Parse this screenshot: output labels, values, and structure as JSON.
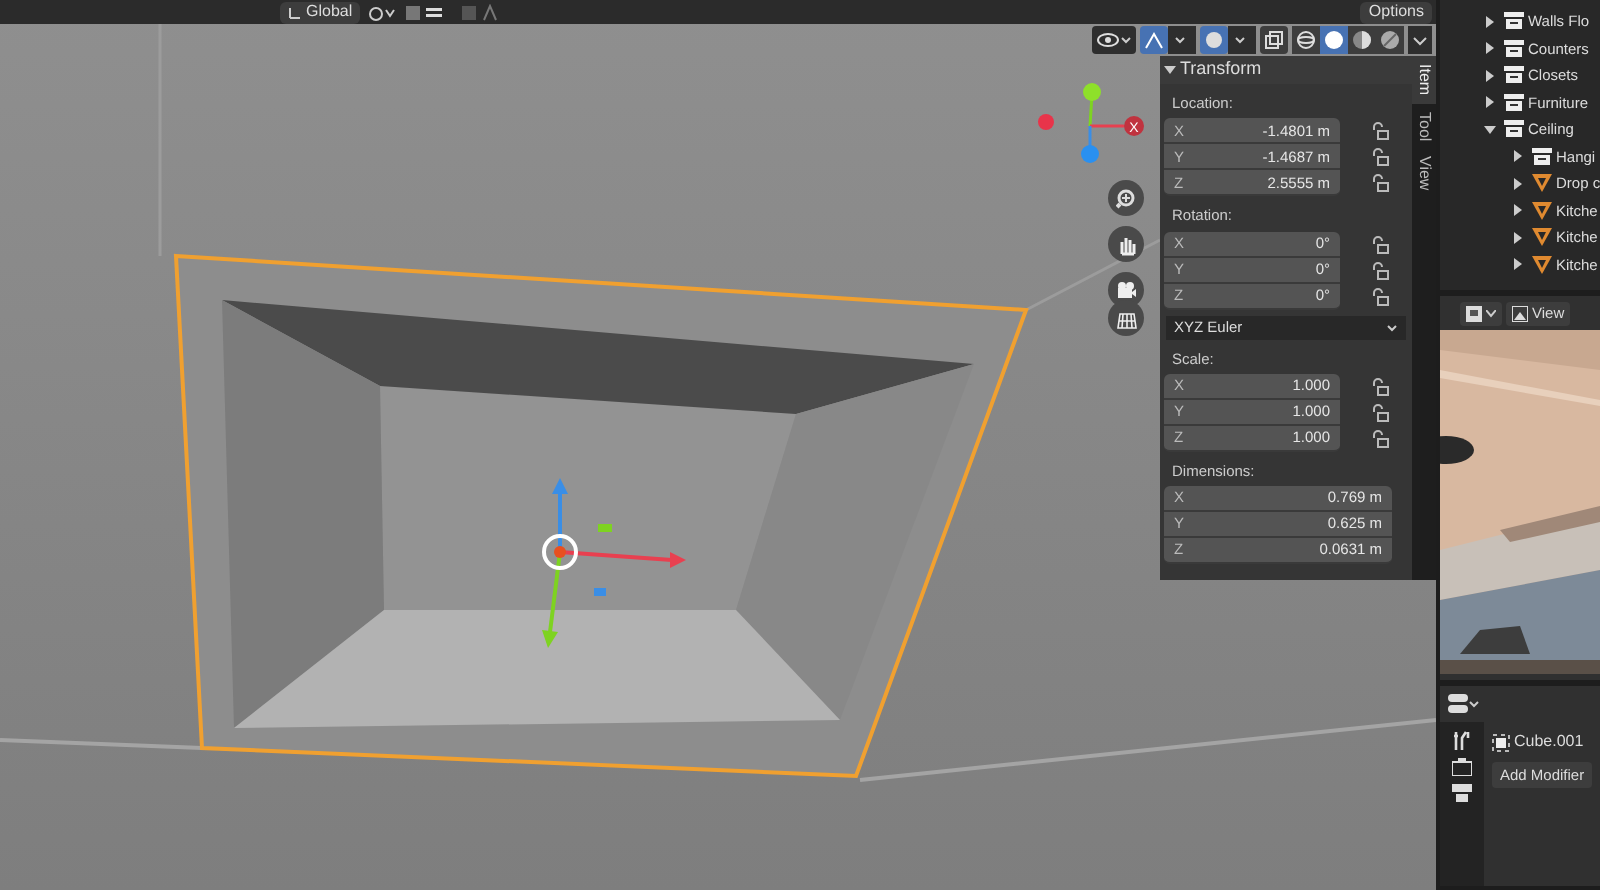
{
  "top_bar": {
    "orientation": "Global",
    "options": "Options"
  },
  "viewport_header": {
    "shading": [
      {
        "kind": "wireframe",
        "selected": false
      },
      {
        "kind": "solid",
        "selected": true
      },
      {
        "kind": "material",
        "selected": false
      },
      {
        "kind": "rendered",
        "selected": false
      }
    ]
  },
  "gizmo": {
    "x_axis": "X"
  },
  "sidebar": {
    "tabs": [
      {
        "label": "Item",
        "selected": true
      },
      {
        "label": "Tool",
        "selected": false
      },
      {
        "label": "View",
        "selected": false
      }
    ],
    "panel": {
      "title": "Transform",
      "expanded": true,
      "groups": [
        {
          "label": "Location:",
          "locks": true,
          "fields": [
            {
              "axis": "X",
              "value": "-1.4801 m"
            },
            {
              "axis": "Y",
              "value": "-1.4687 m"
            },
            {
              "axis": "Z",
              "value": "2.5555 m"
            }
          ]
        },
        {
          "label": "Rotation:",
          "locks": true,
          "fields": [
            {
              "axis": "X",
              "value": "0°"
            },
            {
              "axis": "Y",
              "value": "0°"
            },
            {
              "axis": "Z",
              "value": "0°"
            }
          ],
          "mode": "XYZ Euler"
        },
        {
          "label": "Scale:",
          "locks": true,
          "fields": [
            {
              "axis": "X",
              "value": "1.000"
            },
            {
              "axis": "Y",
              "value": "1.000"
            },
            {
              "axis": "Z",
              "value": "1.000"
            }
          ]
        },
        {
          "label": "Dimensions:",
          "locks": false,
          "fields": [
            {
              "axis": "X",
              "value": "0.769 m"
            },
            {
              "axis": "Y",
              "value": "0.625 m"
            },
            {
              "axis": "Z",
              "value": "0.0631 m"
            }
          ]
        }
      ]
    }
  },
  "outliner": {
    "items": [
      {
        "label": "Walls Flo",
        "kind": "collection",
        "expanded": false
      },
      {
        "label": "Counters",
        "kind": "collection",
        "expanded": false
      },
      {
        "label": "Closets",
        "kind": "collection",
        "expanded": false
      },
      {
        "label": "Furniture",
        "kind": "collection",
        "expanded": false
      },
      {
        "label": "Ceiling",
        "kind": "collection",
        "expanded": true,
        "children": [
          {
            "label": "Hangi",
            "kind": "collection",
            "expanded": false
          },
          {
            "label": "Drop c",
            "kind": "mesh",
            "expanded": false
          },
          {
            "label": "Kitche",
            "kind": "mesh",
            "expanded": false
          },
          {
            "label": "Kitche",
            "kind": "mesh",
            "expanded": false
          },
          {
            "label": "Kitche",
            "kind": "mesh",
            "expanded": false
          }
        ]
      }
    ]
  },
  "image_editor": {
    "menu": "View"
  },
  "properties": {
    "object_name": "Cube.001",
    "add_modifier": "Add Modifier"
  }
}
